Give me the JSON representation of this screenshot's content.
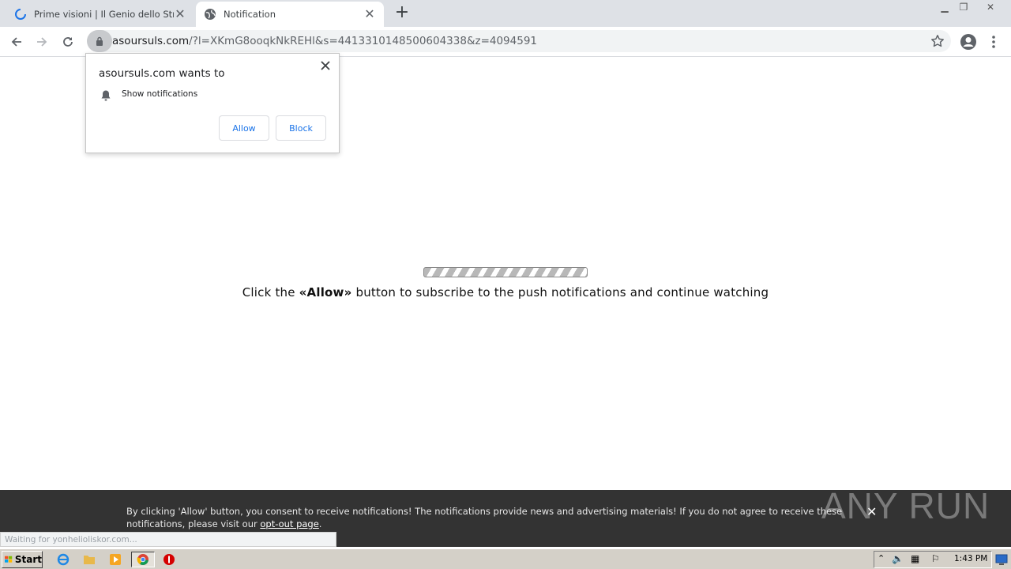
{
  "tabs": [
    {
      "title": "Prime visioni | Il Genio dello Streaming",
      "icon": "loading-spinner-icon"
    },
    {
      "title": "Notification",
      "icon": "globe-icon"
    }
  ],
  "address": {
    "domain": "asoursuls.com",
    "rest": "/?l=XKmG8ooqkNkREHl&s=4413310148500604338&z=4094591"
  },
  "popup": {
    "heading": "asoursuls.com wants to",
    "permission": "Show notifications",
    "allow_label": "Allow",
    "block_label": "Block"
  },
  "page": {
    "msg_before": "Click the ",
    "msg_bold": "«Allow»",
    "msg_after": " button to subscribe to the push notifications and continue watching"
  },
  "banner": {
    "text": "By clicking 'Allow' button, you consent to receive notifications! The notifications provide news and advertising materials! If you do not agree to receive these notifications, please visit our ",
    "link": "opt-out page",
    "suffix": "."
  },
  "status": "Waiting for yonhelioliskor.com...",
  "watermark": "ANY RUN",
  "taskbar": {
    "start_label": "Start",
    "clock": "1:43 PM"
  },
  "colors": {
    "accent": "#1a73e8",
    "banner_bg": "#333333",
    "tabstrip_bg": "#dee1e6",
    "taskbar_bg": "#d4d0c8"
  }
}
